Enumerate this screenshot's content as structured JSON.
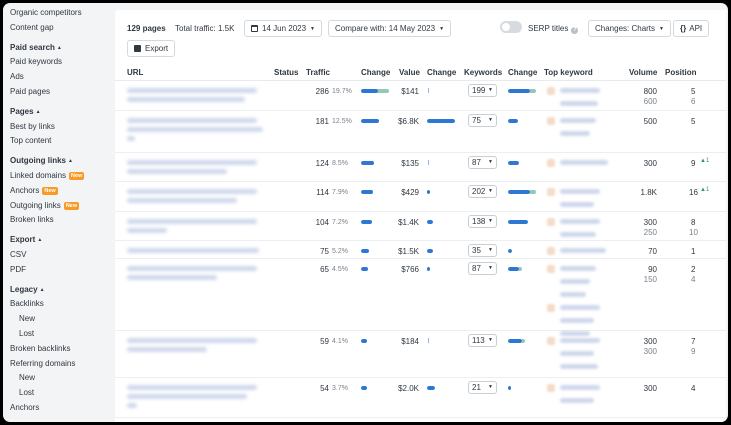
{
  "sidebar": {
    "top": [
      "Organic competitors",
      "Content gap"
    ],
    "groups": [
      {
        "title": "Paid search",
        "items": [
          {
            "label": "Paid keywords"
          },
          {
            "label": "Ads"
          },
          {
            "label": "Paid pages"
          }
        ]
      },
      {
        "title": "Pages",
        "items": [
          {
            "label": "Best by links"
          },
          {
            "label": "Top content"
          }
        ]
      },
      {
        "title": "Outgoing links",
        "items": [
          {
            "label": "Linked domains",
            "badge": "New"
          },
          {
            "label": "Anchors",
            "badge": "New"
          },
          {
            "label": "Outgoing links",
            "badge": "New"
          },
          {
            "label": "Broken links"
          }
        ]
      },
      {
        "title": "Export",
        "items": [
          {
            "label": "CSV"
          },
          {
            "label": "PDF"
          }
        ]
      },
      {
        "title": "Legacy",
        "items": [
          {
            "label": "Backlinks"
          },
          {
            "label": "New",
            "sub": true
          },
          {
            "label": "Lost",
            "sub": true
          },
          {
            "label": "Broken backlinks"
          },
          {
            "label": "Referring domains"
          },
          {
            "label": "New",
            "sub": true
          },
          {
            "label": "Lost",
            "sub": true
          },
          {
            "label": "Anchors"
          }
        ]
      }
    ]
  },
  "toolbar": {
    "pages_count": "129 pages",
    "total_traffic": "Total traffic: 1.5K",
    "date": "14 Jun 2023",
    "compare": "Compare with: 14 May 2023",
    "serp_titles": "SERP titles",
    "changes": "Changes: Charts",
    "api": "API",
    "export": "Export"
  },
  "table": {
    "headers": {
      "url": "URL",
      "status": "Status",
      "traffic": "Traffic",
      "change1": "Change",
      "value": "Value",
      "change2": "Change",
      "keywords": "Keywords",
      "change3": "Change",
      "top_keyword": "Top keyword",
      "volume": "Volume",
      "position": "Position"
    },
    "rows": [
      {
        "traffic": "286",
        "pct": "19.7%",
        "value": "$141",
        "keywords": "199",
        "volume": [
          "800",
          "600"
        ],
        "position": [
          "5",
          "6"
        ],
        "up": "",
        "traffic_fill": 0.6,
        "traffic_fill2": 0.4,
        "value_fill": 0.0,
        "kw_fill": 0.8,
        "kw_fill2": 0.2,
        "url_lines": [
          130,
          118
        ],
        "kw_items": [
          [
            40
          ],
          [
            38
          ]
        ],
        "h": 30
      },
      {
        "traffic": "181",
        "pct": "12.5%",
        "value": "$6.8K",
        "keywords": "75",
        "volume": [
          "500"
        ],
        "position": [
          "5"
        ],
        "up": "",
        "traffic_fill": 0.65,
        "traffic_fill2": 0,
        "value_fill": 1.0,
        "kw_fill": 0.35,
        "kw_fill2": 0,
        "url_lines": [
          130,
          136,
          8
        ],
        "kw_items": [
          [
            36
          ],
          [
            30
          ]
        ],
        "h": 42
      },
      {
        "traffic": "124",
        "pct": "8.5%",
        "value": "$135",
        "keywords": "87",
        "volume": [
          "300"
        ],
        "position": [
          "9"
        ],
        "up": "1",
        "traffic_fill": 0.45,
        "traffic_fill2": 0,
        "value_fill": 0.0,
        "kw_fill": 0.4,
        "kw_fill2": 0,
        "url_lines": [
          130,
          100
        ],
        "kw_items": [
          [
            48
          ]
        ],
        "h": 29
      },
      {
        "traffic": "114",
        "pct": "7.9%",
        "value": "$429",
        "keywords": "202",
        "volume": [
          "1.8K"
        ],
        "position": [
          "16"
        ],
        "up": "1",
        "traffic_fill": 0.42,
        "traffic_fill2": 0,
        "value_fill": 0.05,
        "kw_fill": 0.8,
        "kw_fill2": 0.2,
        "url_lines": [
          130,
          110
        ],
        "kw_items": [
          [
            40
          ],
          [
            34
          ]
        ],
        "h": 30
      },
      {
        "traffic": "104",
        "pct": "7.2%",
        "value": "$1.4K",
        "keywords": "138",
        "volume": [
          "300",
          "250"
        ],
        "position": [
          "8",
          "10"
        ],
        "up": "",
        "traffic_fill": 0.4,
        "traffic_fill2": 0,
        "value_fill": 0.2,
        "kw_fill": 0.7,
        "kw_fill2": 0,
        "url_lines": [
          130,
          40
        ],
        "kw_items": [
          [
            40
          ],
          [
            36
          ]
        ],
        "h": 29
      },
      {
        "traffic": "75",
        "pct": "5.2%",
        "value": "$1.5K",
        "keywords": "35",
        "volume": [
          "70"
        ],
        "position": [
          "1"
        ],
        "up": "",
        "traffic_fill": 0.28,
        "traffic_fill2": 0,
        "value_fill": 0.22,
        "kw_fill": 0.15,
        "kw_fill2": 0,
        "url_lines": [
          132
        ],
        "kw_items": [
          [
            46
          ]
        ],
        "h": 18
      },
      {
        "traffic": "65",
        "pct": "4.5%",
        "value": "$766",
        "keywords": "87",
        "volume": [
          "90",
          "150"
        ],
        "position": [
          "2",
          "4"
        ],
        "up": "",
        "traffic_fill": 0.25,
        "traffic_fill2": 0,
        "value_fill": 0.08,
        "kw_fill": 0.4,
        "kw_fill2": 0.1,
        "url_lines": [
          130,
          90
        ],
        "kw_items": [
          [
            36
          ],
          [
            30
          ],
          [
            26
          ],
          [
            40
          ],
          [
            34
          ],
          [
            30
          ]
        ],
        "h": 72
      },
      {
        "traffic": "59",
        "pct": "4.1%",
        "value": "$184",
        "keywords": "113",
        "volume": [
          "300",
          "300"
        ],
        "position": [
          "7",
          "9"
        ],
        "up": "",
        "traffic_fill": 0.22,
        "traffic_fill2": 0,
        "value_fill": 0.0,
        "kw_fill": 0.5,
        "kw_fill2": 0.1,
        "url_lines": [
          130,
          80
        ],
        "kw_items": [
          [
            40
          ],
          [
            34
          ],
          [
            38
          ]
        ],
        "h": 47
      },
      {
        "traffic": "54",
        "pct": "3.7%",
        "value": "$2.0K",
        "keywords": "21",
        "volume": [
          "300"
        ],
        "position": [
          "4"
        ],
        "up": "",
        "traffic_fill": 0.2,
        "traffic_fill2": 0,
        "value_fill": 0.3,
        "kw_fill": 0.1,
        "kw_fill2": 0,
        "url_lines": [
          130,
          120,
          10
        ],
        "kw_items": [
          [
            40
          ],
          [
            34
          ]
        ],
        "h": 40
      }
    ]
  }
}
